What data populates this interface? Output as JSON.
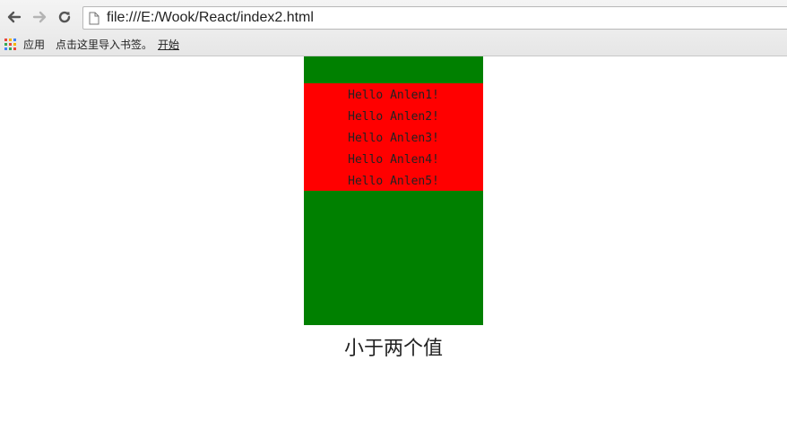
{
  "browser": {
    "url": "file:///E:/Wook/React/index2.html",
    "icons": {
      "back": "back-arrow-icon",
      "forward": "forward-arrow-icon",
      "reload": "reload-icon",
      "page": "page-icon",
      "apps": "apps-grid-icon"
    },
    "bookmarks": {
      "apps_label": "应用",
      "import_label": "点击这里导入书签。",
      "start_label": "开始"
    }
  },
  "page": {
    "hello_lines": [
      "Hello Anlen1!",
      "Hello Anlen2!",
      "Hello Anlen3!",
      "Hello Anlen4!",
      "Hello Anlen5!"
    ],
    "caption": "小于两个值",
    "colors": {
      "outer_box": "#008000",
      "inner_box": "#ff0000"
    }
  }
}
